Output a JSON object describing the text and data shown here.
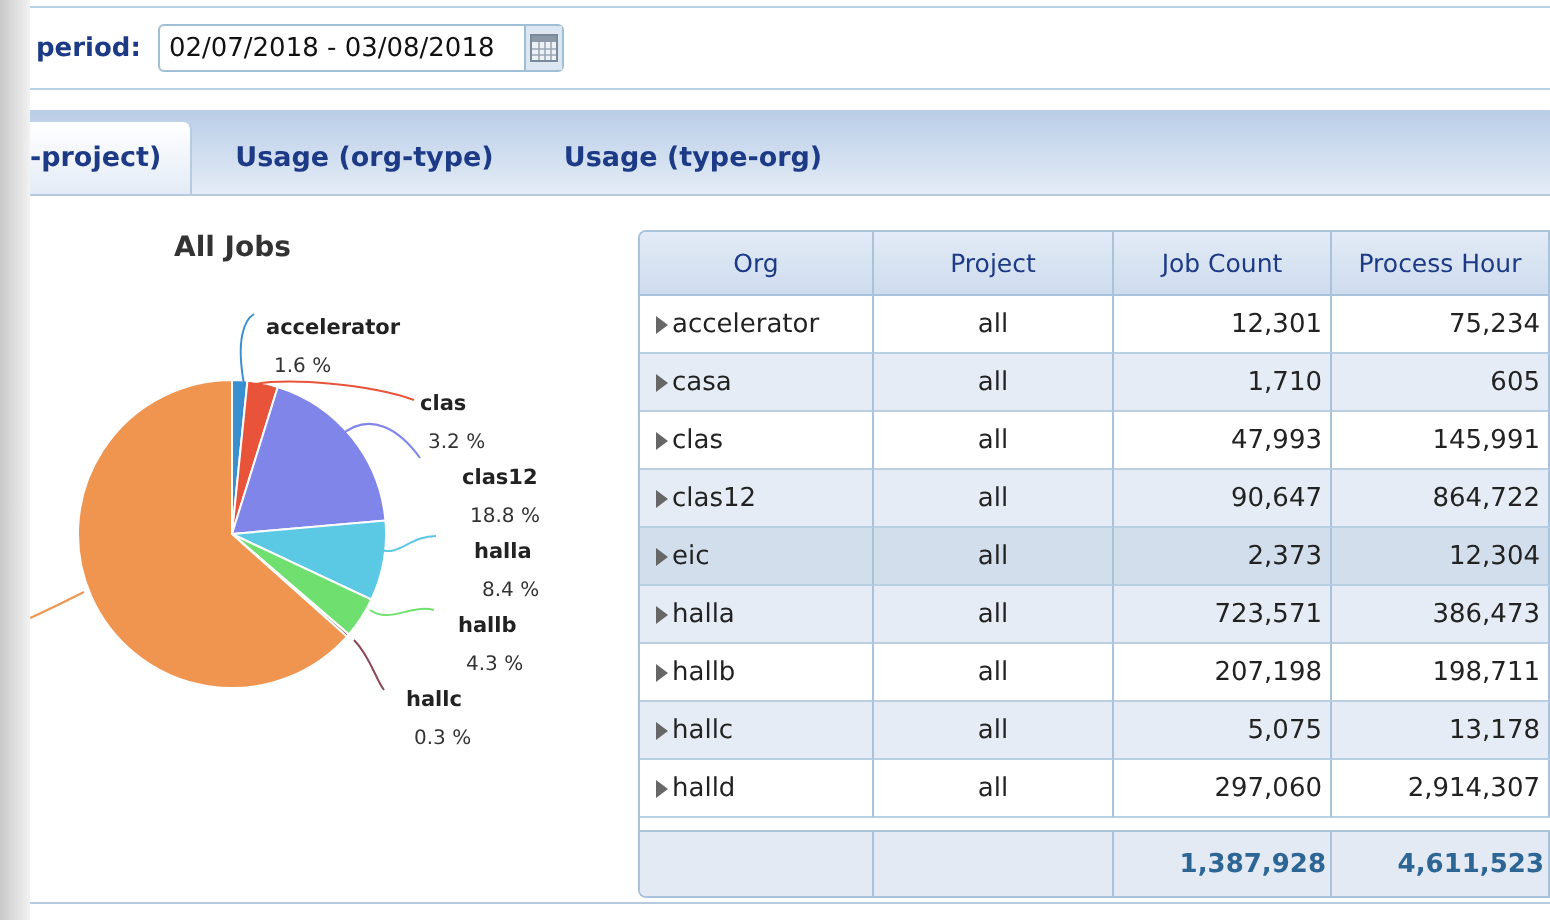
{
  "filter": {
    "label": "period:",
    "value": "02/07/2018 - 03/08/2018"
  },
  "tabs": [
    {
      "label": "-project)",
      "selected": true
    },
    {
      "label": "Usage (org-type)",
      "selected": false
    },
    {
      "label": "Usage (type-org)",
      "selected": false
    }
  ],
  "chart": {
    "title": "All Jobs",
    "chart_data": {
      "type": "pie",
      "categories": [
        "accelerator",
        "clas",
        "clas12",
        "halla",
        "hallb",
        "hallc",
        null
      ],
      "values": [
        1.6,
        3.2,
        18.8,
        8.4,
        4.3,
        0.3,
        63.4
      ],
      "value_labels": [
        "1.6 %",
        "3.2 %",
        "18.8 %",
        "8.4 %",
        "4.3 %",
        "0.3 %",
        null
      ]
    }
  },
  "table": {
    "columns": [
      "Org",
      "Project",
      "Job Count",
      "Process Hour"
    ],
    "rows": [
      {
        "org": "accelerator",
        "project": "all",
        "job_count": "12,301",
        "process_hour": "75,234",
        "expanded": false,
        "selected": false
      },
      {
        "org": "casa",
        "project": "all",
        "job_count": "1,710",
        "process_hour": "605",
        "expanded": false,
        "selected": false
      },
      {
        "org": "clas",
        "project": "all",
        "job_count": "47,993",
        "process_hour": "145,991",
        "expanded": false,
        "selected": false
      },
      {
        "org": "clas12",
        "project": "all",
        "job_count": "90,647",
        "process_hour": "864,722",
        "expanded": false,
        "selected": false
      },
      {
        "org": "eic",
        "project": "all",
        "job_count": "2,373",
        "process_hour": "12,304",
        "expanded": false,
        "selected": true
      },
      {
        "org": "halla",
        "project": "all",
        "job_count": "723,571",
        "process_hour": "386,473",
        "expanded": false,
        "selected": false
      },
      {
        "org": "hallb",
        "project": "all",
        "job_count": "207,198",
        "process_hour": "198,711",
        "expanded": false,
        "selected": false
      },
      {
        "org": "hallc",
        "project": "all",
        "job_count": "5,075",
        "process_hour": "13,178",
        "expanded": false,
        "selected": false
      },
      {
        "org": "halld",
        "project": "all",
        "job_count": "297,060",
        "process_hour": "2,914,307",
        "expanded": false,
        "selected": false
      }
    ],
    "totals": {
      "job_count": "1,387,928",
      "process_hour": "4,611,523"
    }
  }
}
